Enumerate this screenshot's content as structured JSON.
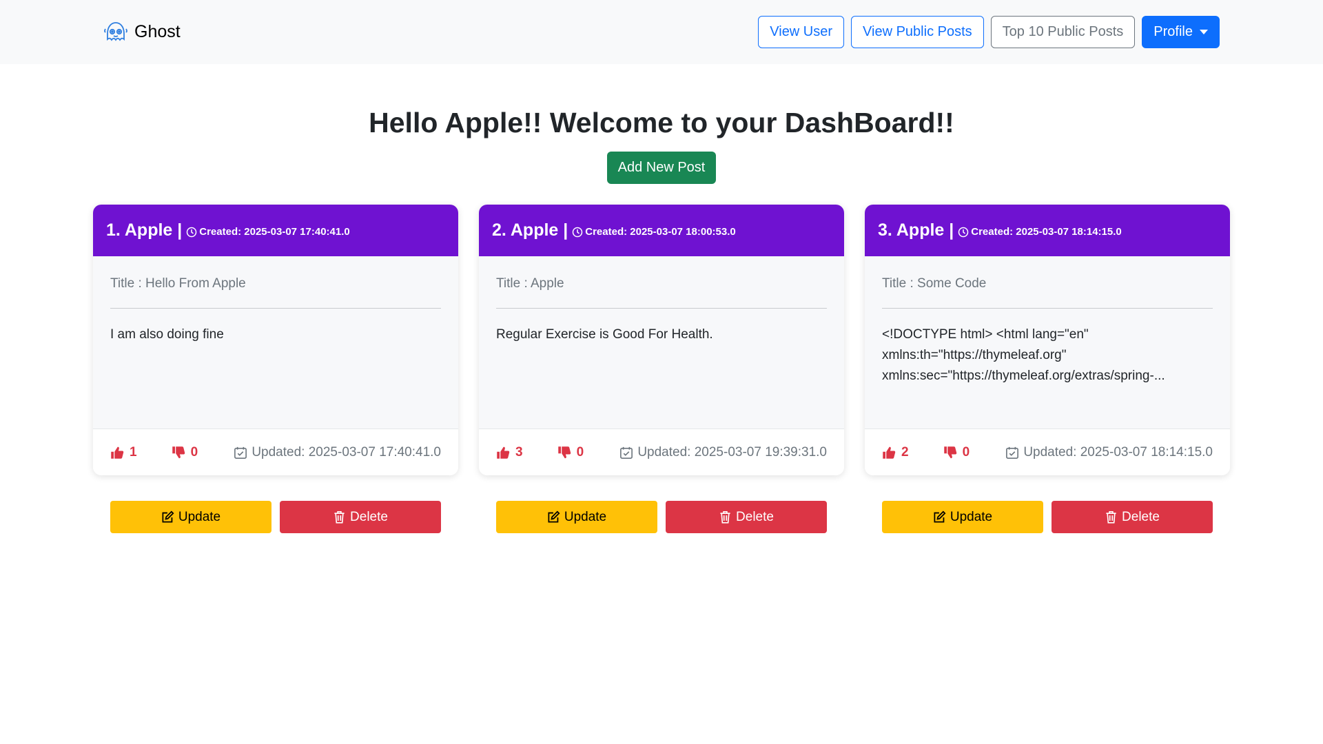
{
  "navbar": {
    "brand": "Ghost",
    "buttons": {
      "view_user": "View User",
      "view_public_posts": "View Public Posts",
      "top_posts": "Top 10 Public Posts",
      "profile": "Profile"
    }
  },
  "heading": "Hello Apple!! Welcome to your DashBoard!!",
  "add_post_label": "Add New Post",
  "posts": [
    {
      "header": "1. Apple |",
      "created": "Created: 2025-03-07 17:40:41.0",
      "title": "Title : Hello From Apple",
      "content": "I am also doing fine",
      "likes": "1",
      "dislikes": "0",
      "updated": "Updated: 2025-03-07 17:40:41.0",
      "update_label": "Update",
      "delete_label": "Delete"
    },
    {
      "header": "2. Apple |",
      "created": "Created: 2025-03-07 18:00:53.0",
      "title": "Title : Apple",
      "content": "Regular Exercise is Good For Health.",
      "likes": "3",
      "dislikes": "0",
      "updated": "Updated: 2025-03-07 19:39:31.0",
      "update_label": "Update",
      "delete_label": "Delete"
    },
    {
      "header": "3. Apple |",
      "created": "Created: 2025-03-07 18:14:15.0",
      "title": "Title : Some Code",
      "content": "<!DOCTYPE html> <html lang=\"en\" xmlns:th=\"https://thymeleaf.org\" xmlns:sec=\"https://thymeleaf.org/extras/spring-...",
      "likes": "2",
      "dislikes": "0",
      "updated": "Updated: 2025-03-07 18:14:15.0",
      "update_label": "Update",
      "delete_label": "Delete"
    }
  ],
  "colors": {
    "card_header": "#6f12d1",
    "primary": "#0d6efd",
    "success": "#198754",
    "warning": "#ffc107",
    "danger": "#dc3545"
  }
}
